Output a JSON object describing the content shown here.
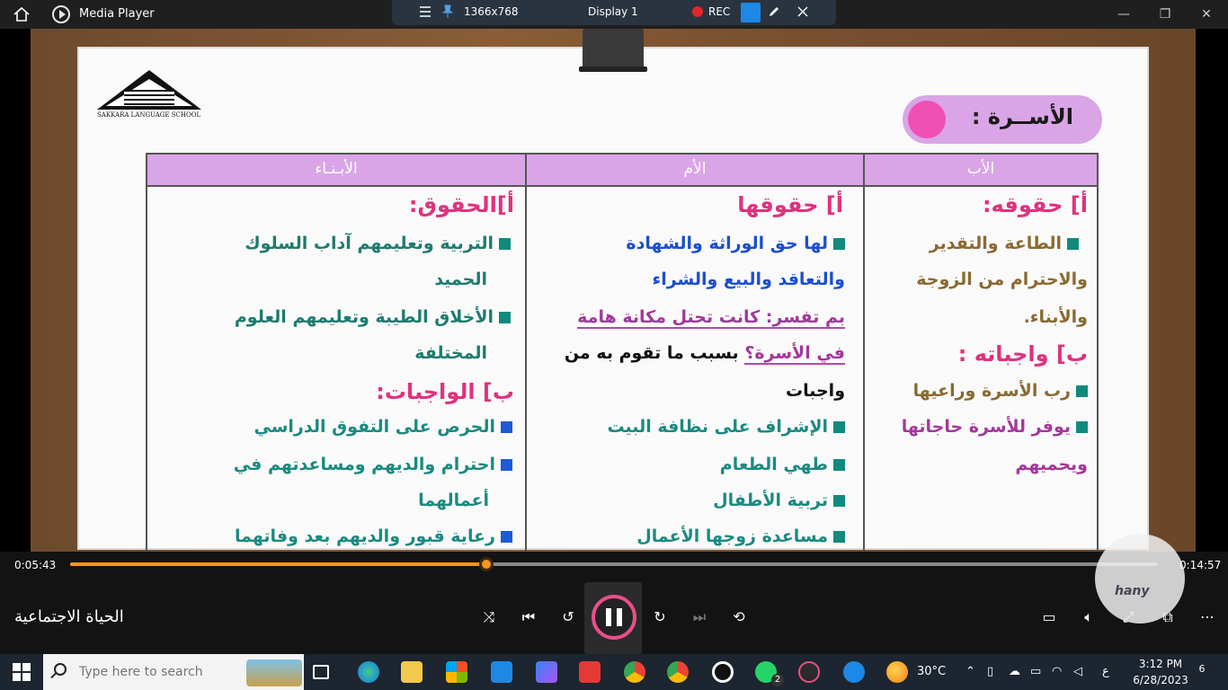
{
  "window": {
    "app_title": "Media Player",
    "minimize": "—",
    "restore": "❐",
    "close": "✕"
  },
  "remote_toolbar": {
    "resolution": "1366x768",
    "display": "Display 1",
    "rec_label": "REC"
  },
  "slide": {
    "school_name": "SAKKARA LANGUAGE SCHOOL",
    "family_title": "الأســرة :",
    "table": {
      "headers": {
        "father": "الأب",
        "mother": "الأم",
        "children": "الأبـنـاء"
      },
      "father": {
        "rights_heading": "أ] حقوقه:",
        "rights_line1": "الطاعة والتقدير",
        "rights_line2": "والاحترام من الزوجة",
        "rights_line3": "والأبناء.",
        "duties_heading": "ب] واجباته :",
        "duty1": "رب الأسرة وراعيها",
        "duty2_line1": "يوفر للأسرة حاجاتها",
        "duty2_line2": "ويحميهم"
      },
      "mother": {
        "rights_heading": "أ] حقوقها",
        "rights_line1": "لها حق الوراثة والشهادة",
        "rights_line2": "والتعاقد والبيع والشراء",
        "explain_line1": "بم تفسر: كانت تحتل مكانة هامة",
        "explain_line2_a": "في الأسرة؟",
        "explain_line2_b": "بسبب ما تقوم به من",
        "explain_line3": "واجبات",
        "duty1": "الإشراف على  نظافة البيت",
        "duty2": "طهي الطعام",
        "duty3": "تربية الأطفال",
        "duty4": "مساعدة زوجها الأعمال"
      },
      "children": {
        "rights_heading": "أ]الحقوق:",
        "rights_line1": "التربية وتعليمهم آداب السلوك",
        "rights_line2": "الحميد",
        "rights_line3": "الأخلاق الطيبة وتعليمهم العلوم",
        "rights_line4": "المختلفة",
        "duties_heading": "ب] الواجبات:",
        "duty1": "الحرص على التفوق الدراسي",
        "duty2_line1": "احترام والديهم ومساعدتهم في",
        "duty2_line2": "أعمالهما",
        "duty3": "رعاية قبور والديهم بعد وفاتهما"
      }
    }
  },
  "player": {
    "elapsed": "0:05:43",
    "duration": "0:14:57",
    "progress_fraction": 0.3823,
    "video_title": "الحياة الاجتماعية",
    "watermark": "hany",
    "colors": {
      "accent": "#f7941d",
      "play_ring": "#e84f8a"
    }
  },
  "taskbar": {
    "search_placeholder": "Type here to search",
    "whatsapp_badge": "2",
    "weather_temp": "30°C",
    "keyboard_lang": "ع",
    "time": "3:12 PM",
    "date": "6/28/2023",
    "notifications": "6"
  }
}
